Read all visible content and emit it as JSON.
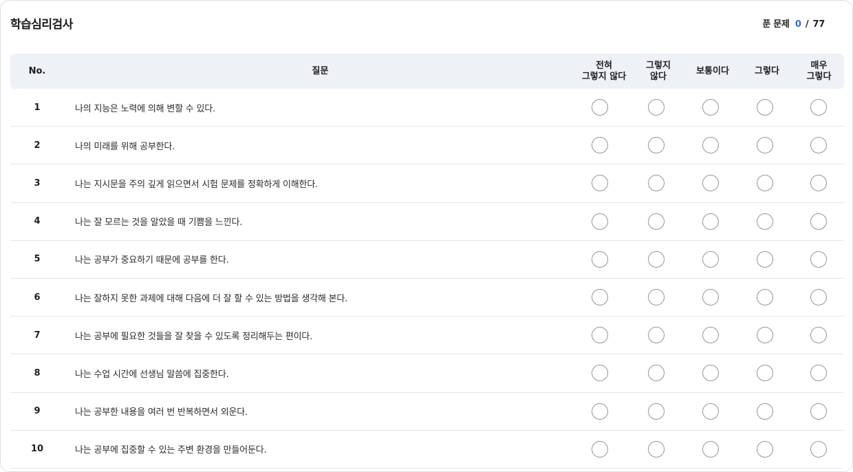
{
  "header": {
    "title": "학습심리검사",
    "progress_label": "푼 문제",
    "progress_done": "0",
    "progress_sep": "/",
    "progress_total": "77"
  },
  "table": {
    "col_no": "No.",
    "col_question": "질문",
    "options": [
      "전혀\n그렇지 않다",
      "그렇지\n않다",
      "보통이다",
      "그렇다",
      "매우\n그렇다"
    ]
  },
  "questions": [
    {
      "no": "1",
      "text": "나의 지능은 노력에 의해 변할 수 있다."
    },
    {
      "no": "2",
      "text": "나의 미래를 위해 공부한다."
    },
    {
      "no": "3",
      "text": "나는 지시문을 주의 깊게 읽으면서 시험 문제를 정확하게 이해한다."
    },
    {
      "no": "4",
      "text": "나는 잘 모르는 것을 알았을 때 기쁨을 느낀다."
    },
    {
      "no": "5",
      "text": "나는 공부가 중요하기 때문에 공부를 한다."
    },
    {
      "no": "6",
      "text": "나는 잘하지 못한 과제에 대해 다음에 더 잘 할 수 있는 방법을 생각해 본다."
    },
    {
      "no": "7",
      "text": "나는 공부에 필요한 것들을 잘 찾을 수 있도록 정리해두는 편이다."
    },
    {
      "no": "8",
      "text": "나는 수업 시간에 선생님 말씀에 집중한다."
    },
    {
      "no": "9",
      "text": "나는 공부한 내용을 여러 번 반복하면서 외운다."
    },
    {
      "no": "10",
      "text": "나는 공부에 집중할 수 있는 주변 환경을 만들어둔다."
    }
  ],
  "colors": {
    "accent": "#2f6fe0",
    "header_bg": "#eef1f6",
    "divider": "#e4e6ea"
  }
}
